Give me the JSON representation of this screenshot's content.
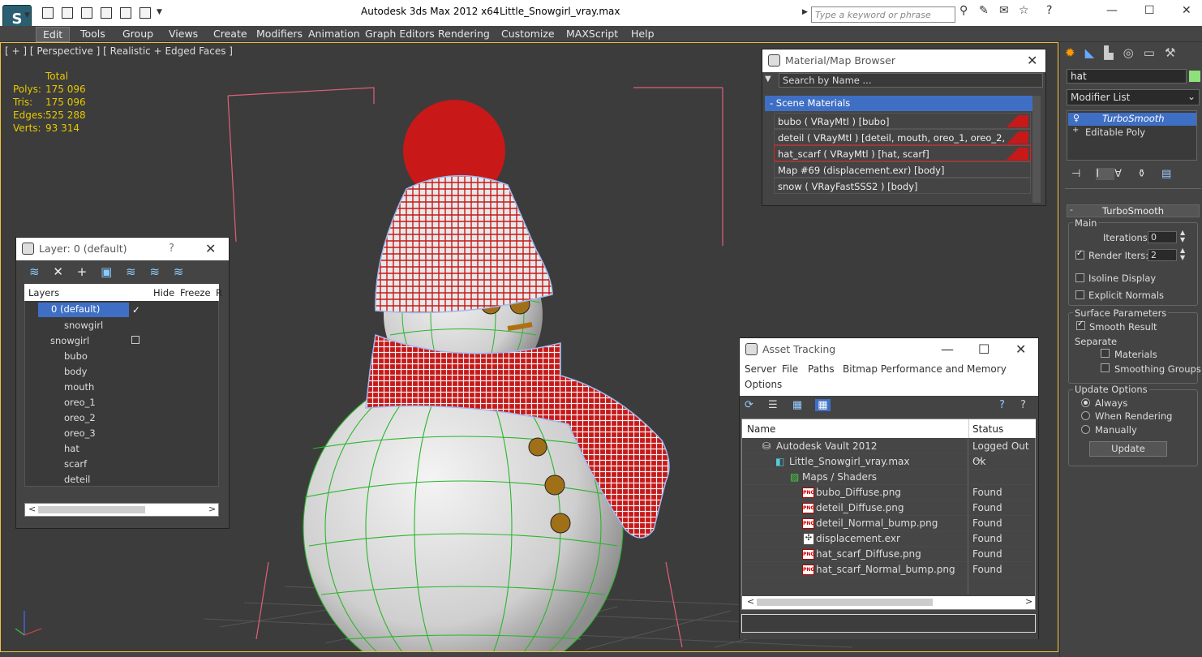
{
  "title": {
    "app": "Autodesk 3ds Max  2012 x64",
    "file": "Little_Snowgirl_vray.max"
  },
  "search": {
    "placeholder": "Type a keyword or phrase"
  },
  "menu": [
    "Edit",
    "Tools",
    "Group",
    "Views",
    "Create",
    "Modifiers",
    "Animation",
    "Graph Editors",
    "Rendering",
    "Customize",
    "MAXScript",
    "Help"
  ],
  "viewport": {
    "label": "[ + ] [ Perspective ] [ Realistic + Edged Faces ]",
    "stats": {
      "header": "Total",
      "polys_label": "Polys:",
      "polys": "175 096",
      "tris_label": "Tris:",
      "tris": "175 096",
      "edges_label": "Edges:",
      "edges": "525 288",
      "verts_label": "Verts:",
      "verts": "93 314"
    }
  },
  "layer_window": {
    "title": "Layer: 0 (default)",
    "help": "?",
    "col_layers": "Layers",
    "col_hide": "Hide",
    "col_freeze": "Freeze",
    "col_extra": "R",
    "rows": [
      "0 (default)",
      "snowgirl",
      "snowgirl",
      "bubo",
      "body",
      "mouth",
      "oreo_1",
      "oreo_2",
      "oreo_3",
      "hat",
      "scarf",
      "deteil"
    ]
  },
  "material_browser": {
    "title": "Material/Map Browser",
    "search_placeholder": "Search by Name ...",
    "section": "- Scene Materials",
    "items": [
      "bubo  ( VRayMtl )  [bubo]",
      "deteil  ( VRayMtl )  [deteil, mouth, oreo_1, oreo_2, oreo_3]",
      "hat_scarf  ( VRayMtl )  [hat, scarf]",
      "Map #69 (displacement.exr) [body]",
      "snow  ( VRayFastSSS2 )  [body]"
    ]
  },
  "asset_tracking": {
    "title": "Asset Tracking",
    "menu": [
      "Server",
      "File",
      "Paths",
      "Bitmap Performance and Memory",
      "Options"
    ],
    "col_name": "Name",
    "col_status": "Status",
    "rows": [
      {
        "name": "Autodesk Vault 2012",
        "status": "Logged Out ...",
        "icon": "vault-icon"
      },
      {
        "name": "Little_Snowgirl_vray.max",
        "status": "Ok",
        "icon": "max-file-icon"
      },
      {
        "name": "Maps / Shaders",
        "status": "",
        "icon": "maps-icon"
      },
      {
        "name": "bubo_Diffuse.png",
        "status": "Found",
        "icon": "png-icon"
      },
      {
        "name": "deteil_Diffuse.png",
        "status": "Found",
        "icon": "png-icon"
      },
      {
        "name": "deteil_Normal_bump.png",
        "status": "Found",
        "icon": "png-icon"
      },
      {
        "name": "displacement.exr",
        "status": "Found",
        "icon": "exr-icon"
      },
      {
        "name": "hat_scarf_Diffuse.png",
        "status": "Found",
        "icon": "png-icon"
      },
      {
        "name": "hat_scarf_Normal_bump.png",
        "status": "Found",
        "icon": "png-icon"
      }
    ],
    "png_tag": "PNG"
  },
  "command_panel": {
    "object_name": "hat",
    "modifier_list": "Modifier List",
    "stack": [
      "TurboSmooth",
      "Editable Poly"
    ],
    "rollout": "TurboSmooth",
    "main": "Main",
    "iterations_label": "Iterations:",
    "iterations": "0",
    "render_iters_label": "Render Iters:",
    "render_iters": "2",
    "isoline": "Isoline Display",
    "explicit": "Explicit Normals",
    "surface": "Surface Parameters",
    "smooth_result": "Smooth Result",
    "separate": "Separate",
    "materials": "Materials",
    "smoothing_groups": "Smoothing Groups",
    "update_options": "Update Options",
    "always": "Always",
    "when_rendering": "When Rendering",
    "manually": "Manually",
    "update": "Update"
  },
  "colors": {
    "accent": "#3f6fc4",
    "wire_green": "#2cb52c",
    "hat_red": "#c81818",
    "stats_yellow": "#e8c800"
  }
}
